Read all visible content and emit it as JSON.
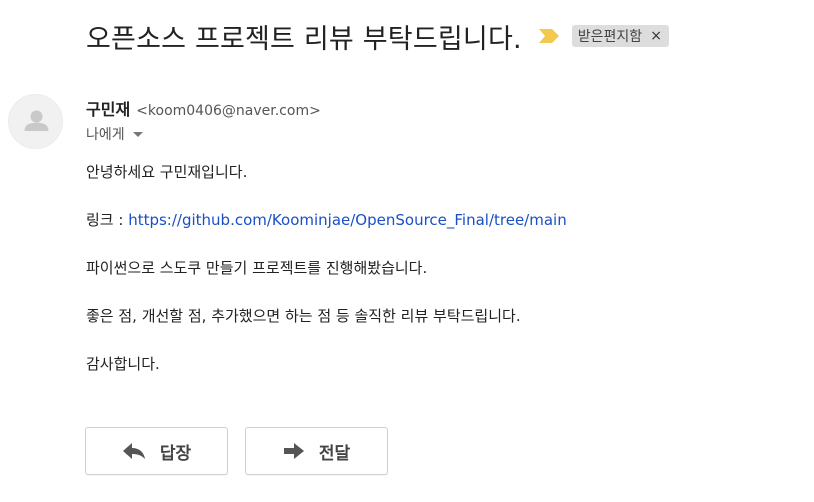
{
  "message": {
    "subject": "오픈소스 프로젝트 리뷰 부탁드립니다.",
    "label": "받은편지함",
    "label_remove": "×",
    "importance_icon": "importance-marker-icon",
    "importance_color": "#f2c94c"
  },
  "sender": {
    "name": "구민재",
    "email": "<koom0406@naver.com>",
    "avatar_icon": "person-icon"
  },
  "recipient": {
    "to_label": "나에게"
  },
  "body": {
    "greeting": "안녕하세요 구민재입니다.",
    "link_label": "링크 : ",
    "link_url": "https://github.com/Koominjae/OpenSource_Final/tree/main",
    "line_project": "파이썬으로 스도쿠 만들기 프로젝트를 진행해봤습니다.",
    "line_request": "좋은 점, 개선할 점, 추가했으면 하는 점 등 솔직한 리뷰 부탁드립니다.",
    "closing": "감사합니다."
  },
  "actions": {
    "reply_label": "답장",
    "forward_label": "전달",
    "reply_icon": "reply-arrow-icon",
    "forward_icon": "forward-arrow-icon"
  },
  "colors": {
    "link": "#1a4fc6",
    "label_chip_bg": "#dddddd"
  }
}
